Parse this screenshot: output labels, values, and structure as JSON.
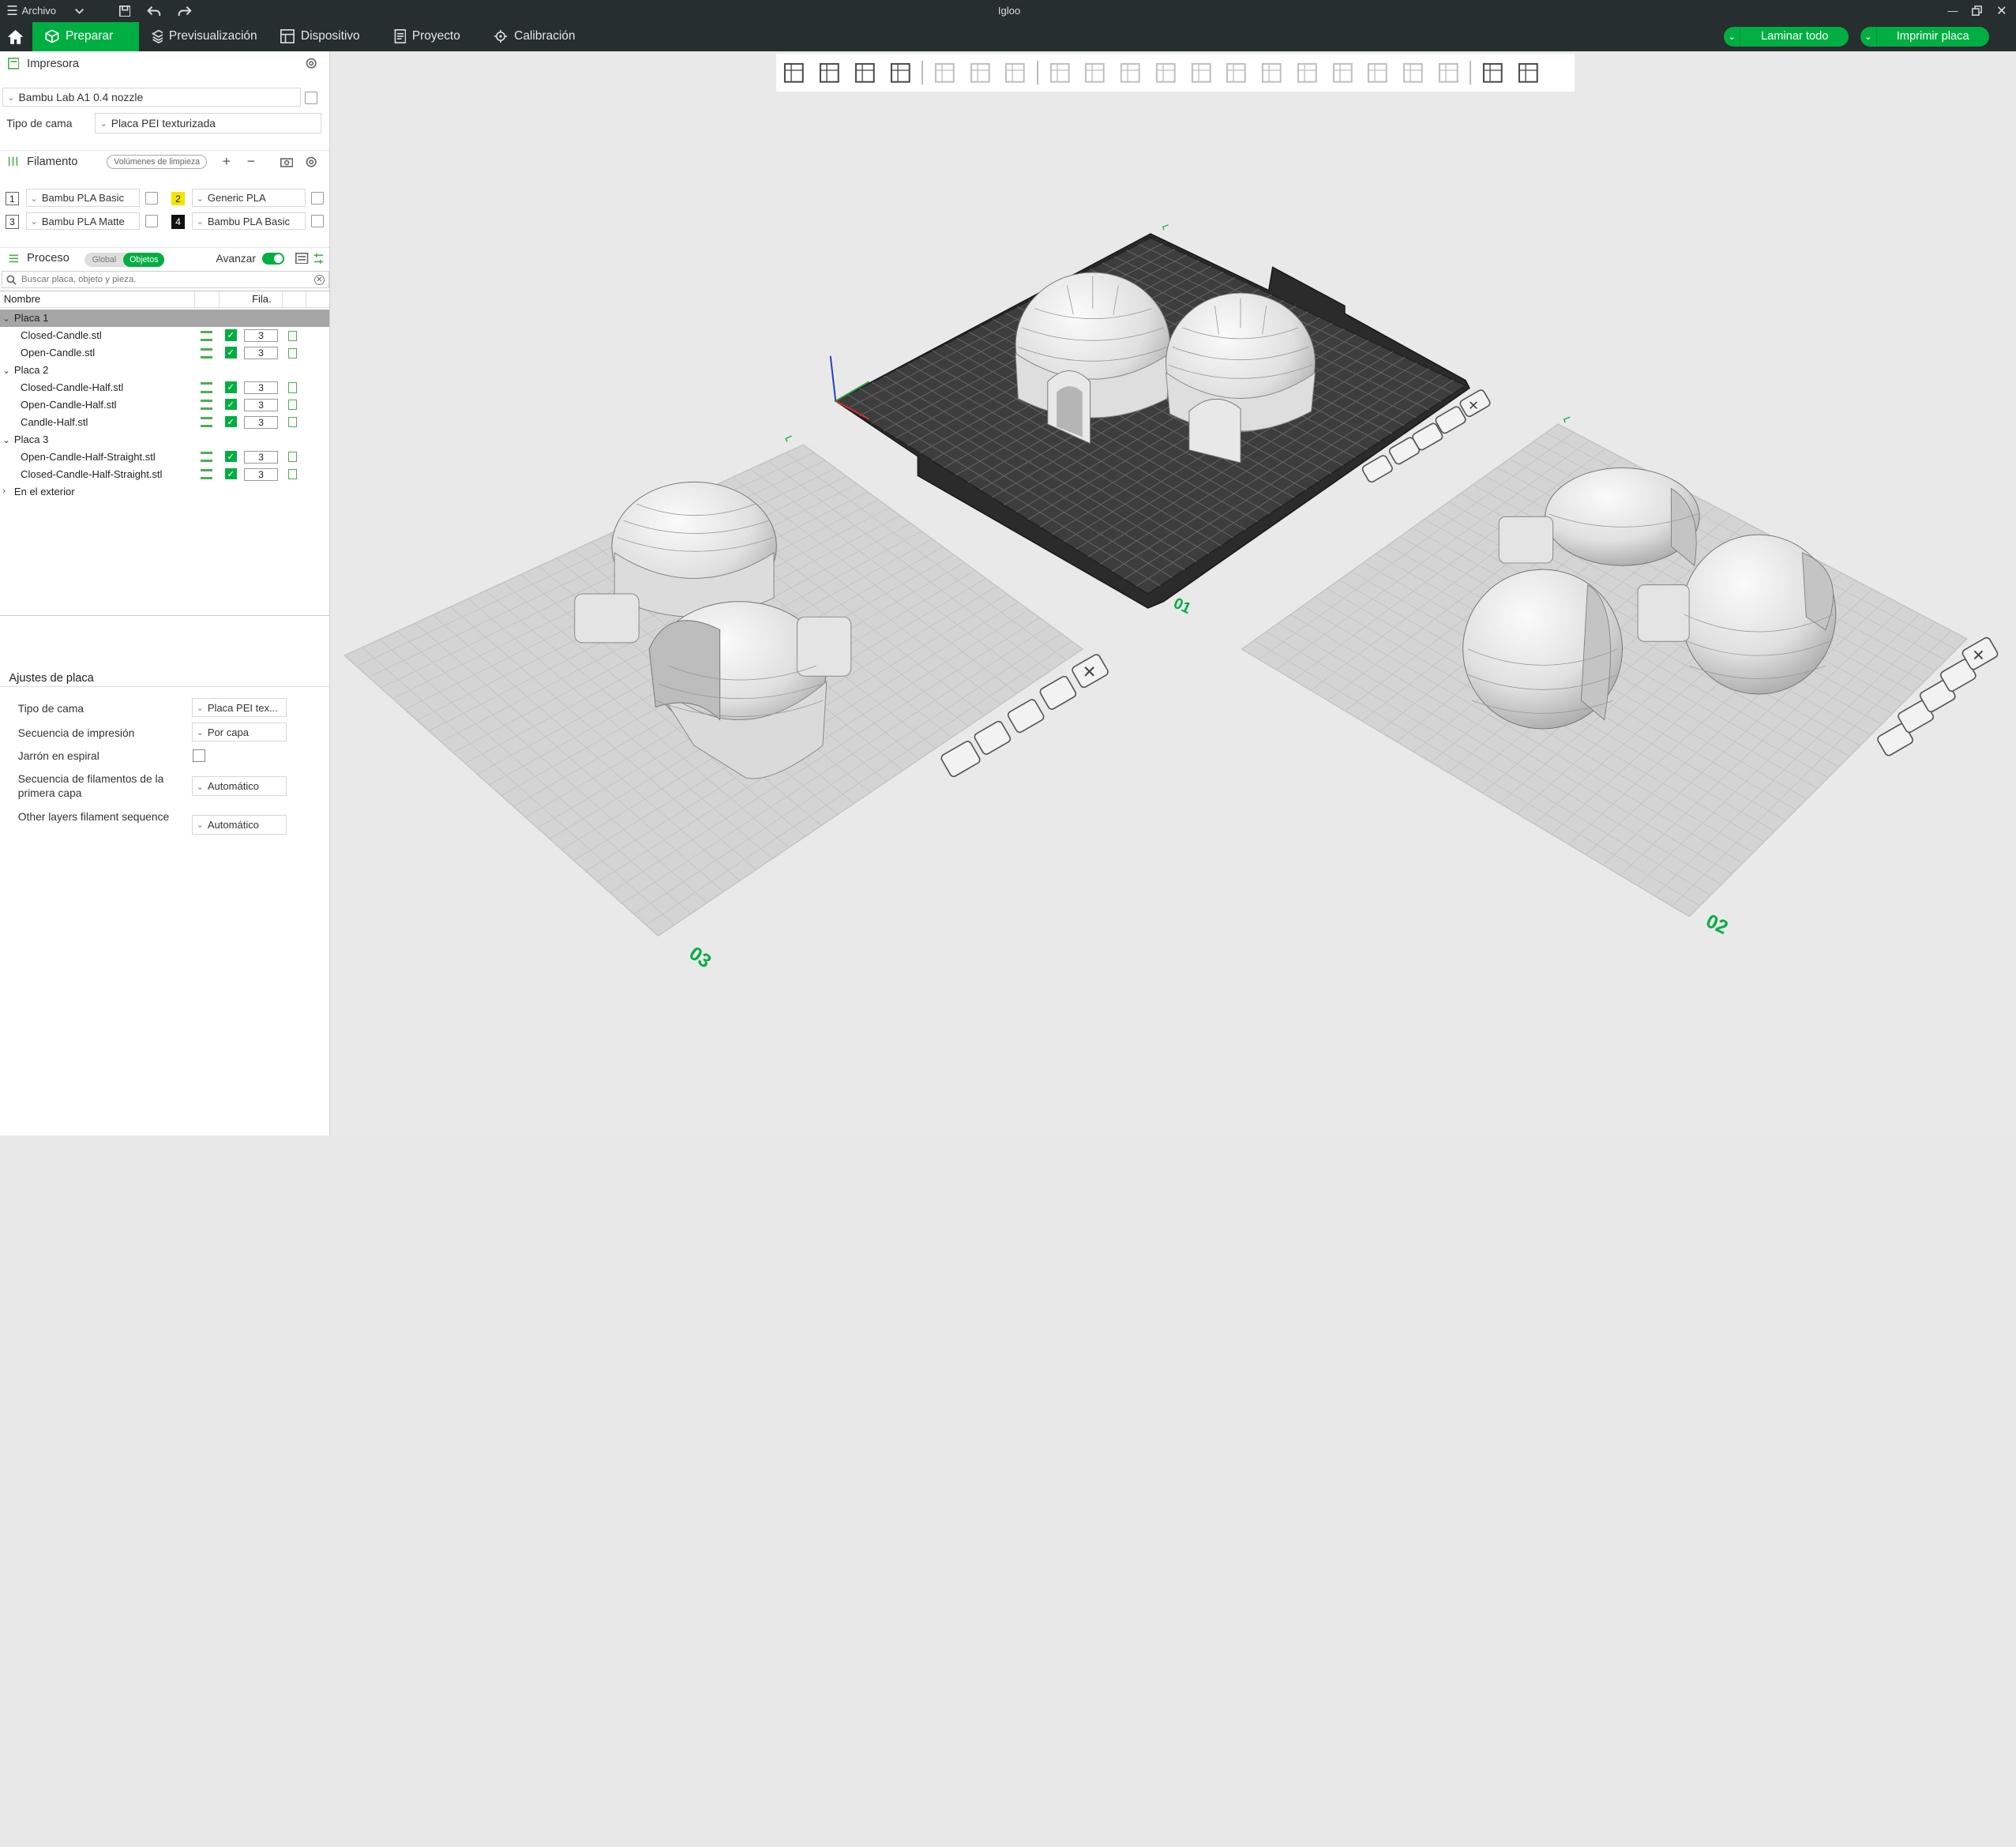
{
  "window": {
    "title": "Igloo",
    "menu_label": "Archivo"
  },
  "tabs": [
    {
      "label": "Preparar",
      "icon": "cube-icon",
      "active": true
    },
    {
      "label": "Previsualización",
      "icon": "layers-icon",
      "active": false
    },
    {
      "label": "Dispositivo",
      "icon": "device-icon",
      "active": false
    },
    {
      "label": "Proyecto",
      "icon": "project-icon",
      "active": false
    },
    {
      "label": "Calibración",
      "icon": "calibration-icon",
      "active": false
    }
  ],
  "actions": {
    "slice_all": "Laminar todo",
    "print_plate": "Imprimir placa"
  },
  "printer": {
    "section_title": "Impresora",
    "name": "Bambu Lab A1 0.4 nozzle",
    "bed_label": "Tipo de cama",
    "bed_value": "Placa PEI texturizada"
  },
  "filament": {
    "section_title": "Filamento",
    "flush_label": "Volúmenes de limpieza",
    "slots": [
      {
        "num": "1",
        "name": "Bambu PLA Basic",
        "color": "#ffffff",
        "text_color": "#333333"
      },
      {
        "num": "2",
        "name": "Generic PLA",
        "color": "#f2e600",
        "text_color": "#333333"
      },
      {
        "num": "3",
        "name": "Bambu PLA Matte",
        "color": "#ffffff",
        "text_color": "#333333"
      },
      {
        "num": "4",
        "name": "Bambu PLA Basic",
        "color": "#111111",
        "text_color": "#ffffff"
      }
    ]
  },
  "process": {
    "section_title": "Proceso",
    "toggle_global": "Global",
    "toggle_objects": "Objetos",
    "advanced_label": "Avanzar",
    "search_placeholder": "Buscar placa, objeto y pieza."
  },
  "object_list": {
    "col_name": "Nombre",
    "col_fil": "Fila.",
    "rows": [
      {
        "type": "plate",
        "label": "Placa 1",
        "selected": true
      },
      {
        "type": "object",
        "label": "Closed-Candle.stl",
        "filament": "3"
      },
      {
        "type": "object",
        "label": "Open-Candle.stl",
        "filament": "3"
      },
      {
        "type": "plate",
        "label": "Placa 2"
      },
      {
        "type": "object",
        "label": "Closed-Candle-Half.stl",
        "filament": "3"
      },
      {
        "type": "object",
        "label": "Open-Candle-Half.stl",
        "filament": "3"
      },
      {
        "type": "object",
        "label": "Candle-Half.stl",
        "filament": "3"
      },
      {
        "type": "plate",
        "label": "Placa 3"
      },
      {
        "type": "object",
        "label": "Open-Candle-Half-Straight.stl",
        "filament": "3"
      },
      {
        "type": "object",
        "label": "Closed-Candle-Half-Straight.stl",
        "filament": "3"
      },
      {
        "type": "group",
        "label": "En el exterior"
      }
    ]
  },
  "plate_settings": {
    "title": "Ajustes de placa",
    "rows": [
      {
        "label": "Tipo de cama",
        "value": "Placa PEI tex...",
        "kind": "combo"
      },
      {
        "label": "Secuencia de impresión",
        "value": "Por capa",
        "kind": "combo"
      },
      {
        "label": "Jarrón en espiral",
        "value": "",
        "kind": "checkbox"
      },
      {
        "label": "Secuencia de filamentos de la primera capa",
        "value": "Automático",
        "kind": "combo"
      },
      {
        "label": "Other layers filament sequence",
        "value": "Automático",
        "kind": "combo"
      }
    ]
  },
  "plates": [
    {
      "label": "01",
      "name": "plate-1",
      "active": true
    },
    {
      "label": "02",
      "name": "plate-2",
      "active": false
    },
    {
      "label": "03",
      "name": "plate-3",
      "active": false
    }
  ],
  "toolbar_icons": [
    "add-object-icon",
    "add-plate-icon",
    "auto-orient-icon",
    "arrange-icon",
    "split-objects-icon",
    "split-parts-icon",
    "layers-settings-icon",
    "move-icon",
    "rotate-icon",
    "scale-icon",
    "lay-on-face-icon",
    "cut-icon",
    "boolean-icon",
    "support-paint-icon",
    "seam-paint-icon",
    "text-icon",
    "color-paint-icon",
    "measure-icon",
    "assembly-icon",
    "fit-view-icon",
    "assembly-view-icon"
  ],
  "colors": {
    "accent": "#00ae42",
    "titlebar": "#262e30",
    "bed_active": "#3a3a3a",
    "bed_inactive": "#d4d4d4",
    "model": "#e6e6e6"
  }
}
